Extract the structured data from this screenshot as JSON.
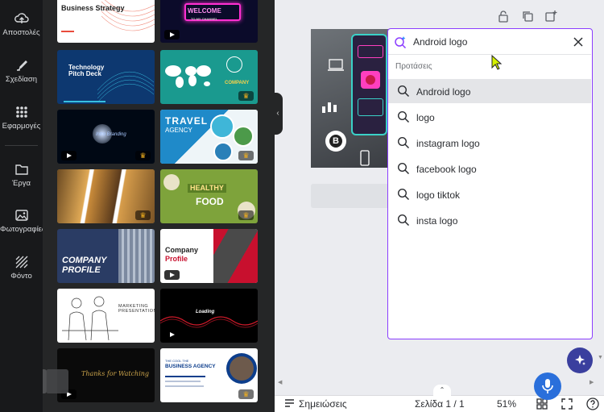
{
  "rail": {
    "items": [
      {
        "label": "Αποστολές",
        "icon": "upload-cloud-icon"
      },
      {
        "label": "Σχεδίαση",
        "icon": "design-brush-icon"
      },
      {
        "label": "Εφαρμογές",
        "icon": "apps-grid-icon"
      },
      {
        "label": "Έργα",
        "icon": "folder-icon"
      },
      {
        "label": "Φωτογραφίες",
        "icon": "photo-icon"
      },
      {
        "label": "Φόντο",
        "icon": "background-hatch-icon"
      }
    ]
  },
  "templates": [
    {
      "title": "Business Strategy",
      "colors": [
        "#ffffff",
        "#e94b3c"
      ]
    },
    {
      "title": "WELCOME",
      "subtitle": "TO MY CHANNEL",
      "colors": [
        "#0b0b2a",
        "#ff2fd1"
      ]
    },
    {
      "title": "Technology Pitch Deck",
      "colors": [
        "#0d3870",
        "#37c0e0"
      ]
    },
    {
      "title": "COMPANY",
      "colors": [
        "#1a9a8f",
        "#ffffff"
      ]
    },
    {
      "title": "Intro Branding",
      "colors": [
        "#000814",
        "#a9c8ff"
      ]
    },
    {
      "title": "TRAVEL",
      "subtitle": "AGENCY",
      "colors": [
        "#eef5f8",
        "#1f8ac9"
      ]
    },
    {
      "title": "",
      "colors": [
        "#b88a3e",
        "#ffffff"
      ]
    },
    {
      "title": "HEALTHY",
      "subtitle": "FOOD",
      "colors": [
        "#7ea33b",
        "#ffe28a"
      ]
    },
    {
      "title": "COMPANY PROFILE",
      "colors": [
        "#2a3c64",
        "#ffffff"
      ]
    },
    {
      "title": "Company",
      "subtitle": "Profile",
      "colors": [
        "#ffffff",
        "#c8102e"
      ]
    },
    {
      "title": "MARKETING PRESENTATION",
      "colors": [
        "#ffffff",
        "#222222"
      ]
    },
    {
      "title": "Loading",
      "colors": [
        "#000000",
        "#d11a2a"
      ]
    },
    {
      "title": "Thanks for Watching",
      "colors": [
        "#0a0a0a",
        "#c9a24a"
      ]
    },
    {
      "title": "BUSINESS AGENCY",
      "subtitle": "THE COOL THE",
      "colors": [
        "#ffffff",
        "#0d3e8c"
      ]
    }
  ],
  "search": {
    "value": "Android logo",
    "suggestions_label": "Προτάσεις",
    "suggestions": [
      "Android logo",
      "logo",
      "instagram logo",
      "facebook logo",
      "logo tiktok",
      "insta logo"
    ]
  },
  "bottom": {
    "notes_label": "Σημειώσεις",
    "page_label": "Σελίδα 1 / 1",
    "zoom": "51%"
  },
  "colors": {
    "accent": "#8b3dff",
    "rail": "#18191b",
    "panel": "#252627"
  }
}
